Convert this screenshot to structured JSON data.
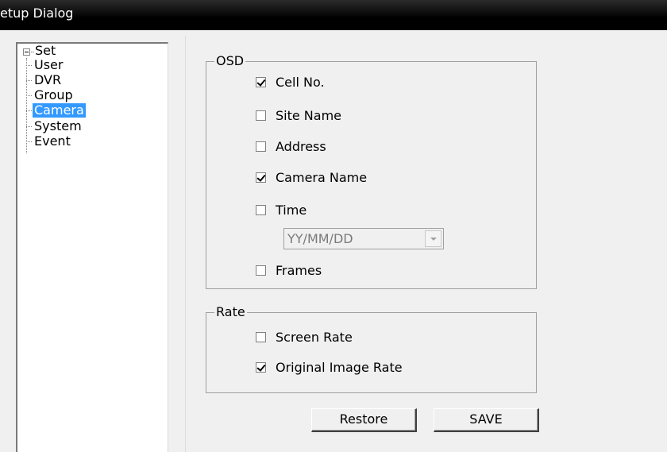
{
  "window": {
    "title": "etup Dialog"
  },
  "tree": {
    "root": "Set",
    "items": [
      {
        "label": "User",
        "selected": false
      },
      {
        "label": "DVR",
        "selected": false
      },
      {
        "label": "Group",
        "selected": false
      },
      {
        "label": "Camera",
        "selected": true
      },
      {
        "label": "System",
        "selected": false
      },
      {
        "label": "Event",
        "selected": false
      }
    ]
  },
  "osd": {
    "title": "OSD",
    "cell_no": {
      "label": "Cell No.",
      "checked": true
    },
    "site_name": {
      "label": "Site Name",
      "checked": false
    },
    "address": {
      "label": "Address",
      "checked": false
    },
    "camera_name": {
      "label": "Camera Name",
      "checked": true
    },
    "time": {
      "label": "Time",
      "checked": false
    },
    "date_format": {
      "value": "YY/MM/DD",
      "disabled": true
    },
    "frames": {
      "label": "Frames",
      "checked": false
    }
  },
  "rate": {
    "title": "Rate",
    "screen_rate": {
      "label": "Screen Rate",
      "checked": false
    },
    "original_image_rate": {
      "label": "Original Image Rate",
      "checked": true
    }
  },
  "buttons": {
    "restore": "Restore",
    "save": "SAVE"
  }
}
